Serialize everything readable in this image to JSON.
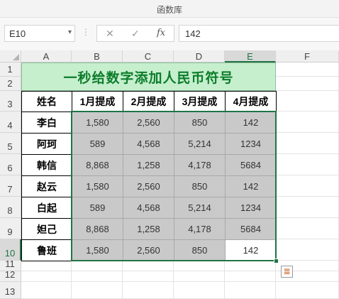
{
  "window": {
    "title": "函数库"
  },
  "formula_bar": {
    "name_box": "E10",
    "name_box_arrow": "▾",
    "dots": "⋮",
    "cancel_symbol": "✕",
    "confirm_symbol": "✓",
    "fx_symbol": "fx",
    "formula_value": "142"
  },
  "columns": [
    "A",
    "B",
    "C",
    "D",
    "E",
    "F"
  ],
  "rows": [
    "1",
    "2",
    "3",
    "4",
    "5",
    "6",
    "7",
    "8",
    "9",
    "10",
    "11",
    "12",
    "13"
  ],
  "sheet": {
    "title": "一秒给数字添加人民币符号",
    "headers": [
      "姓名",
      "1月提成",
      "2月提成",
      "3月提成",
      "4月提成"
    ],
    "data": [
      [
        "李白",
        "1,580",
        "2,560",
        "850",
        "142"
      ],
      [
        "阿珂",
        "589",
        "4,568",
        "5,214",
        "1234"
      ],
      [
        "韩信",
        "8,868",
        "1,258",
        "4,178",
        "5684"
      ],
      [
        "赵云",
        "1,580",
        "2,560",
        "850",
        "142"
      ],
      [
        "白起",
        "589",
        "4,568",
        "5,214",
        "1234"
      ],
      [
        "妲己",
        "8,868",
        "1,258",
        "4,178",
        "5684"
      ],
      [
        "鲁班",
        "1,580",
        "2,560",
        "850",
        "142"
      ]
    ]
  },
  "quick_analysis_icon": "quick-analysis-icon",
  "colors": {
    "title_fill": "#c6efce",
    "title_text": "#0c7d2a",
    "selection": "#217346",
    "value_fill": "#c9c9c9"
  }
}
